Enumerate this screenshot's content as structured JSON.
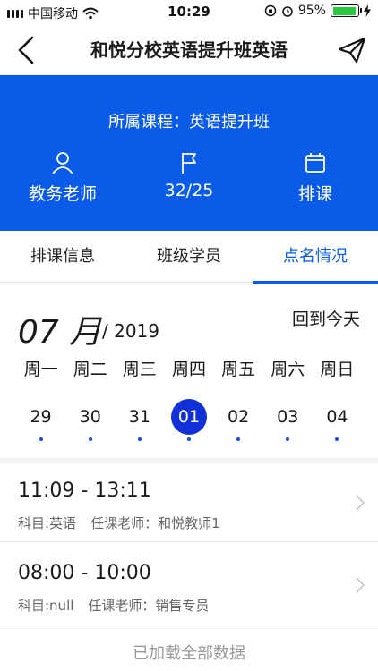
{
  "status_bar": {
    "carrier": "中国移动",
    "time": "10:29",
    "battery": "95%",
    "battery_level": 0.95
  },
  "nav": {
    "title": "和悦分校英语提升班英语"
  },
  "banner": {
    "course": "所属课程：英语提升班",
    "stats": [
      {
        "icon": "person-icon",
        "label": "教务老师"
      },
      {
        "icon": "flag-icon",
        "label": "32/25"
      },
      {
        "icon": "calendar-icon",
        "label": "排课"
      }
    ]
  },
  "tabs": [
    {
      "label": "排课信息",
      "active": false
    },
    {
      "label": "班级学员",
      "active": false
    },
    {
      "label": "点名情况",
      "active": true
    }
  ],
  "calendar": {
    "month": "07 月",
    "year": "/ 2019",
    "today_button": "回到今天",
    "weekdays": [
      "周一",
      "周二",
      "周三",
      "周四",
      "周五",
      "周六",
      "周日"
    ],
    "dates": [
      {
        "num": "29",
        "selected": false
      },
      {
        "num": "30",
        "selected": false
      },
      {
        "num": "31",
        "selected": false
      },
      {
        "num": "01",
        "selected": true
      },
      {
        "num": "02",
        "selected": false
      },
      {
        "num": "03",
        "selected": false
      },
      {
        "num": "04",
        "selected": false
      }
    ]
  },
  "sessions": [
    {
      "time": "11:09 - 13:11",
      "subject": "科目:英语",
      "teacher": "任课老师：和悦教师1"
    },
    {
      "time": "08:00 - 10:00",
      "subject": "科目:null",
      "teacher": "任课老师：销售专员"
    }
  ],
  "footer": "已加载全部数据",
  "colors": {
    "brand_blue": "#0a5be8",
    "selected_date": "#1230d8"
  }
}
